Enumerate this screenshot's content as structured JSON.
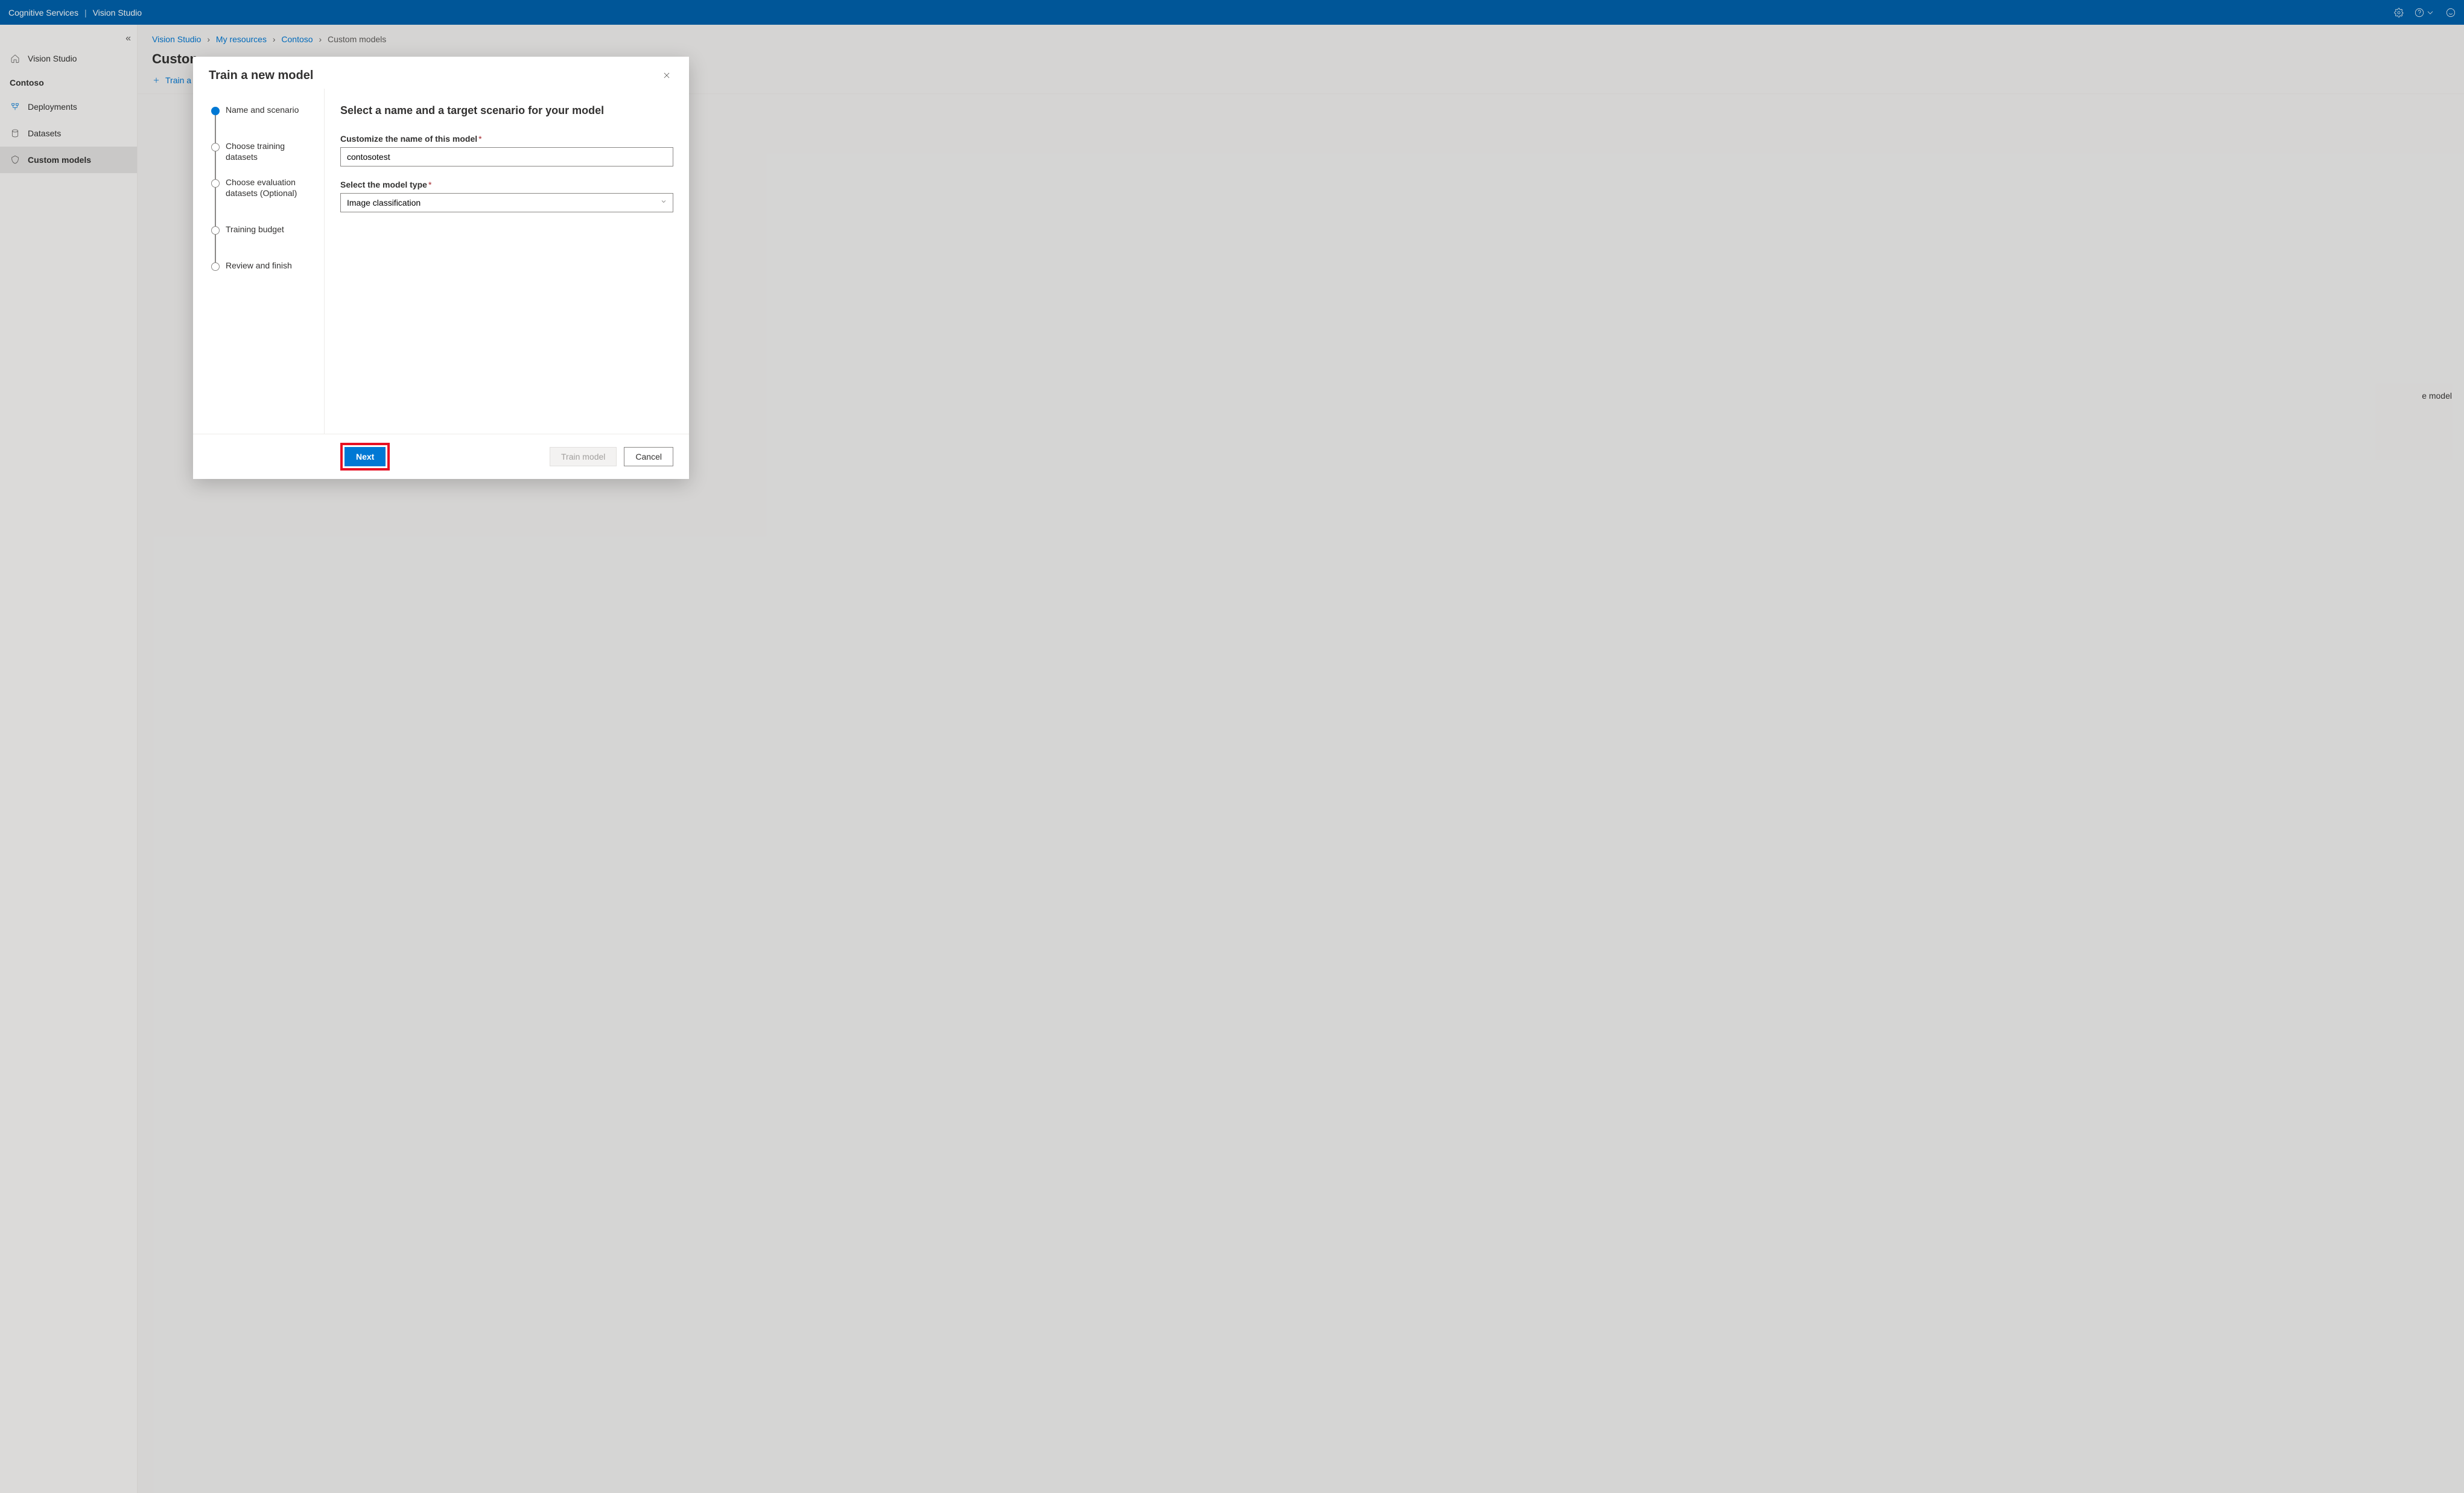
{
  "topbar": {
    "title1": "Cognitive Services",
    "title2": "Vision Studio"
  },
  "sidebar": {
    "home_label": "Vision Studio",
    "section_label": "Contoso",
    "items": [
      {
        "label": "Deployments"
      },
      {
        "label": "Datasets"
      },
      {
        "label": "Custom models"
      }
    ]
  },
  "breadcrumb": {
    "items": [
      "Vision Studio",
      "My resources",
      "Contoso",
      "Custom models"
    ]
  },
  "page": {
    "title_partial": "Custon",
    "train_button_prefix": "Train a"
  },
  "behind_text": "e model",
  "modal": {
    "title": "Train a new model",
    "steps": [
      "Name and scenario",
      "Choose training datasets",
      "Choose evaluation datasets (Optional)",
      "Training budget",
      "Review and finish"
    ],
    "heading": "Select a name and a target scenario for your model",
    "name_label": "Customize the name of this model",
    "name_value": "contosotest",
    "type_label": "Select the model type",
    "type_value": "Image classification",
    "next": "Next",
    "train": "Train model",
    "cancel": "Cancel"
  }
}
